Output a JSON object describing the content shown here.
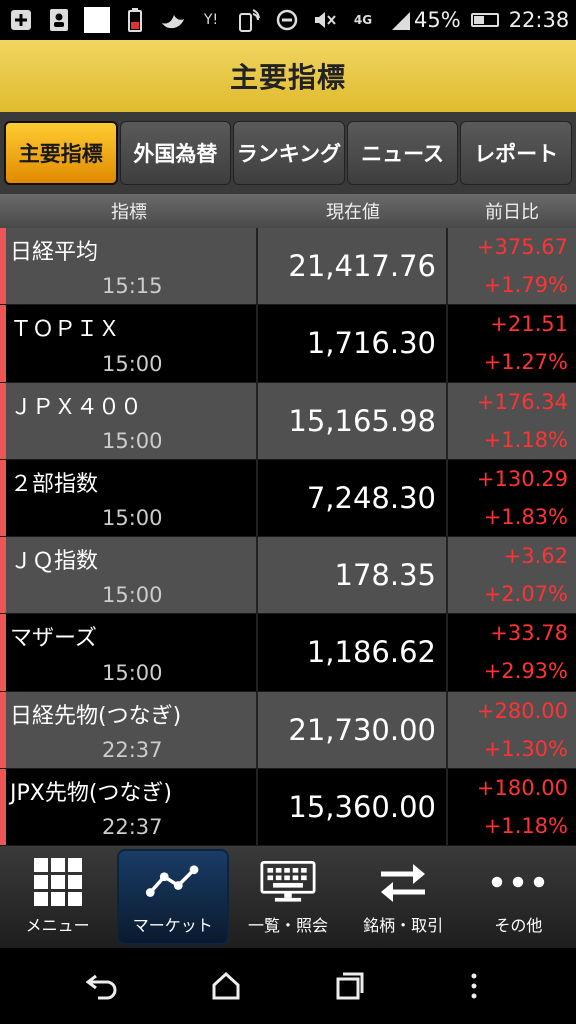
{
  "statusbar": {
    "icons": [
      "add-box-icon",
      "contact-card-icon",
      "white-square-icon",
      "battery-alert-icon",
      "bird-icon",
      "y-mobile-icon",
      "phone-signal-icon",
      "circle-minus-icon",
      "mute-icon",
      "4g-icon",
      "signal-bars-icon"
    ],
    "battery": "45%",
    "time": "22:38"
  },
  "header": {
    "title": "主要指標"
  },
  "tabs": [
    {
      "label": "主要指標",
      "active": true
    },
    {
      "label": "外国為替",
      "active": false
    },
    {
      "label": "ランキング",
      "active": false
    },
    {
      "label": "ニュース",
      "active": false
    },
    {
      "label": "レポート",
      "active": false
    }
  ],
  "columns": {
    "indicator": "指標",
    "current": "現在値",
    "change": "前日比"
  },
  "rows": [
    {
      "name": "日経平均",
      "time": "15:15",
      "value": "21,417.76",
      "change": "+375.67",
      "change_pct": "+1.79%"
    },
    {
      "name": "ＴＯＰＩＸ",
      "time": "15:00",
      "value": "1,716.30",
      "change": "+21.51",
      "change_pct": "+1.27%"
    },
    {
      "name": "ＪＰＸ４００",
      "time": "15:00",
      "value": "15,165.98",
      "change": "+176.34",
      "change_pct": "+1.18%"
    },
    {
      "name": "２部指数",
      "time": "15:00",
      "value": "7,248.30",
      "change": "+130.29",
      "change_pct": "+1.83%"
    },
    {
      "name": "ＪＱ指数",
      "time": "15:00",
      "value": "178.35",
      "change": "+3.62",
      "change_pct": "+2.07%"
    },
    {
      "name": "マザーズ",
      "time": "15:00",
      "value": "1,186.62",
      "change": "+33.78",
      "change_pct": "+2.93%"
    },
    {
      "name": "日経先物(つなぎ)",
      "time": "22:37",
      "value": "21,730.00",
      "change": "+280.00",
      "change_pct": "+1.30%"
    },
    {
      "name": "JPX先物(つなぎ)",
      "time": "22:37",
      "value": "15,360.00",
      "change": "+180.00",
      "change_pct": "+1.18%"
    }
  ],
  "bottomnav": [
    {
      "label": "メニュー",
      "icon": "grid-menu-icon",
      "active": false
    },
    {
      "label": "マーケット",
      "icon": "line-chart-icon",
      "active": true
    },
    {
      "label": "一覧・照会",
      "icon": "keyboard-monitor-icon",
      "active": false
    },
    {
      "label": "銘柄・取引",
      "icon": "swap-arrows-icon",
      "active": false
    },
    {
      "label": "その他",
      "icon": "more-dots-icon",
      "active": false
    }
  ],
  "sysnav": {
    "icons": [
      "back-icon",
      "home-icon",
      "recents-icon",
      "overflow-menu-icon"
    ]
  },
  "colors": {
    "header": "#e8c84a",
    "active_tab": "#f5a800",
    "up": "#ff3333",
    "accent": "#ee5555"
  }
}
